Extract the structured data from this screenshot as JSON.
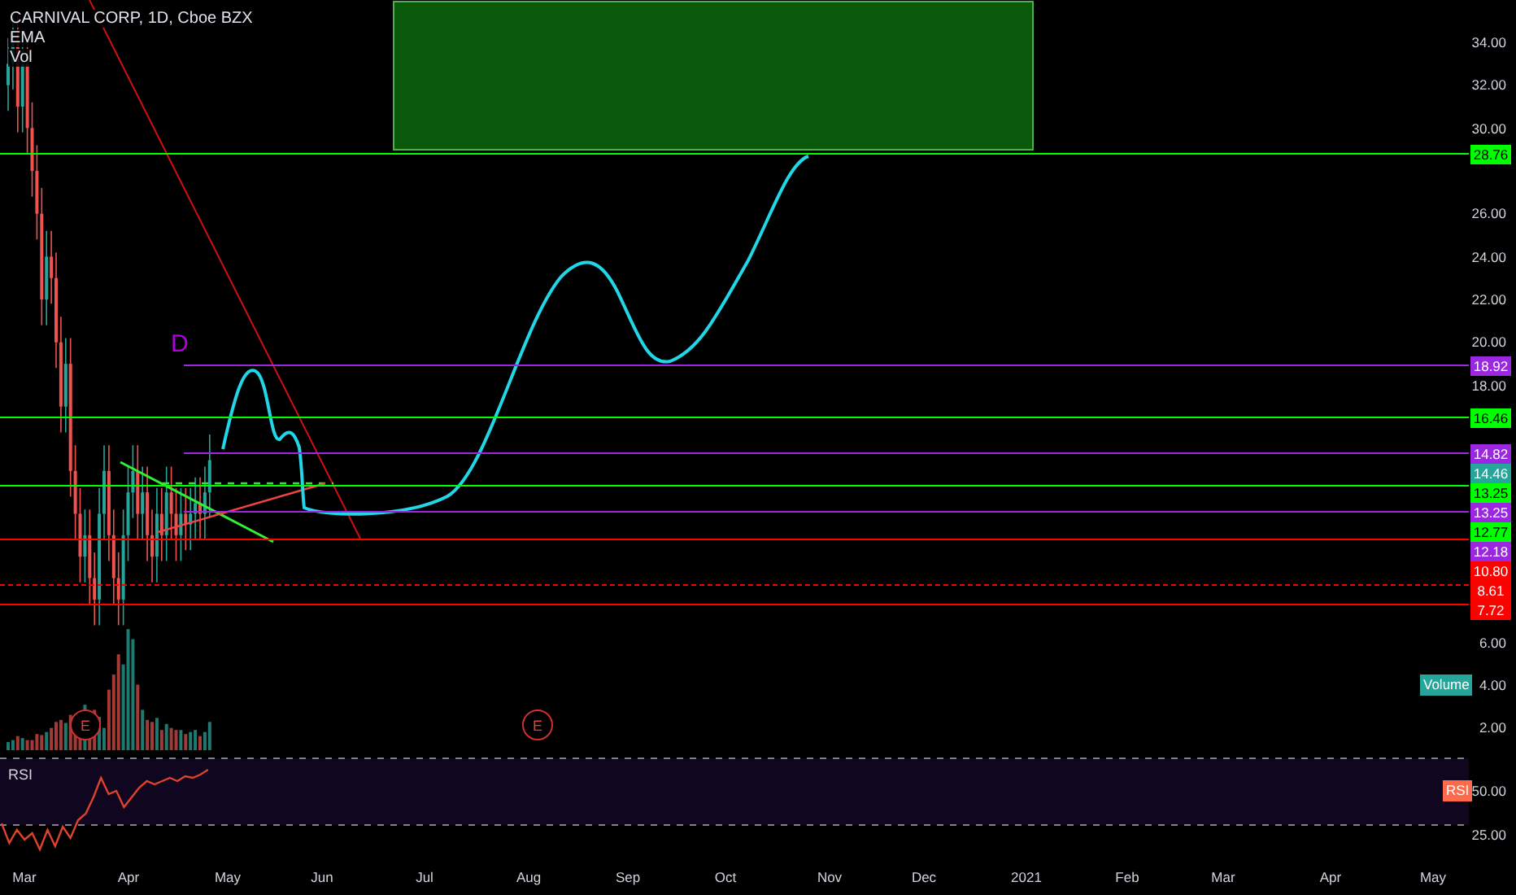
{
  "header": {
    "title": "CARNIVAL CORP, 1D, Cboe BZX",
    "indicators": [
      "EMA",
      "Vol"
    ]
  },
  "price_ticks": [
    "34.00",
    "32.00",
    "30.00",
    "26.00",
    "24.00",
    "22.00",
    "20.00",
    "18.00",
    "6.00"
  ],
  "levels": [
    {
      "label": "28.76",
      "color": "#00ff00",
      "kind": "full",
      "dashed": false
    },
    {
      "label": "18.92",
      "color": "#9c27e0",
      "kind": "partial",
      "dashed": false
    },
    {
      "label": "16.46",
      "color": "#00ff00",
      "kind": "full",
      "dashed": false
    },
    {
      "label": "14.82",
      "color": "#9c27e0",
      "kind": "partial",
      "dashed": false
    },
    {
      "label": "14.46",
      "color": "#26a69a",
      "kind": "label"
    },
    {
      "label": "13.25",
      "color": "#00ff00",
      "kind": "full",
      "dashed": false
    },
    {
      "label": "13.25",
      "color": "#9c27e0",
      "kind": "partial",
      "dashed": false
    },
    {
      "label": "12.77",
      "color": "#00ff00",
      "kind": "label"
    },
    {
      "label": "12.18",
      "color": "#9c27e0",
      "kind": "label"
    },
    {
      "label": "10.80",
      "color": "#ff0000",
      "kind": "full",
      "dashed": false
    },
    {
      "label": "8.61",
      "color": "#ff0000",
      "kind": "full",
      "dashed": true
    },
    {
      "label": "7.72",
      "color": "#ff0000",
      "kind": "full",
      "dashed": false
    }
  ],
  "pattern_label": {
    "text": "D"
  },
  "events": [
    {
      "kind": "earnings",
      "text": "E"
    },
    {
      "kind": "earnings",
      "text": "E"
    }
  ],
  "volume_pane": {
    "badge": "Volume",
    "ticks": [
      "4.00",
      "2.00"
    ]
  },
  "rsi_pane": {
    "title": "RSI",
    "badge": "RSI",
    "ticks": [
      "50.00",
      "25.00"
    ]
  },
  "time_axis": [
    "Mar",
    "Apr",
    "May",
    "Jun",
    "Jul",
    "Aug",
    "Sep",
    "Oct",
    "Nov",
    "Dec",
    "2021",
    "Feb",
    "Mar",
    "Apr",
    "May"
  ]
}
